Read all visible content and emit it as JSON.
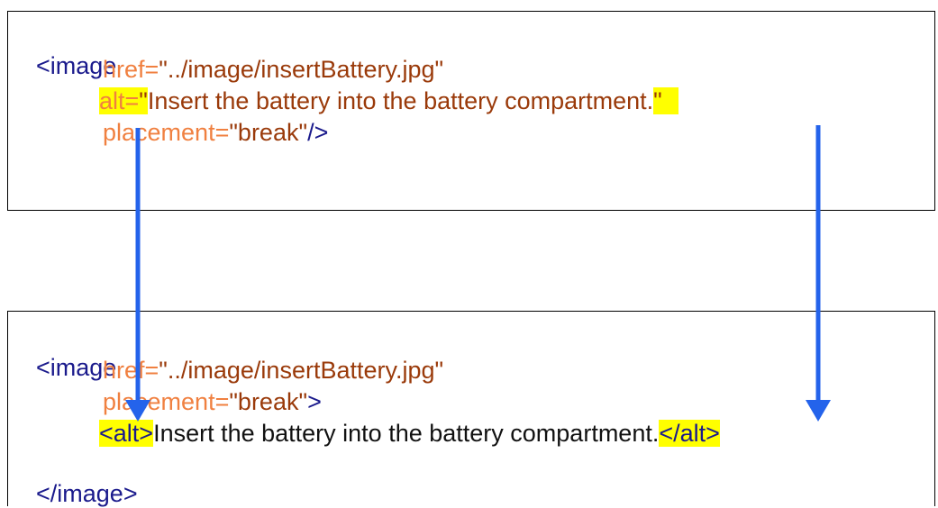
{
  "before": {
    "line1": "<image",
    "href_attr": "href=",
    "href_value": "\"../image/insertBattery.jpg\"",
    "alt_attr": "alt=",
    "alt_open_quote": "\"",
    "alt_text": "Insert the battery into the battery compartment.",
    "alt_close_quote": "\"",
    "placement_attr": "placement=",
    "placement_value": "\"break\"",
    "close_tag": "/>"
  },
  "after": {
    "line1": "<image",
    "href_attr": "href=",
    "href_value": "\"../image/insertBattery.jpg\"",
    "placement_attr": "placement=",
    "placement_value": "\"break\"",
    "placement_close": ">",
    "alt_open": "<alt>",
    "alt_text": "Insert the battery into the battery compartment.",
    "alt_close": "</alt>",
    "end_tag": "</image>"
  },
  "colors": {
    "tag": "#1a1a8c",
    "attribute": "#f08040",
    "value": "#9a3a0a",
    "highlight": "#ffff00",
    "arrow": "#2463eb"
  }
}
